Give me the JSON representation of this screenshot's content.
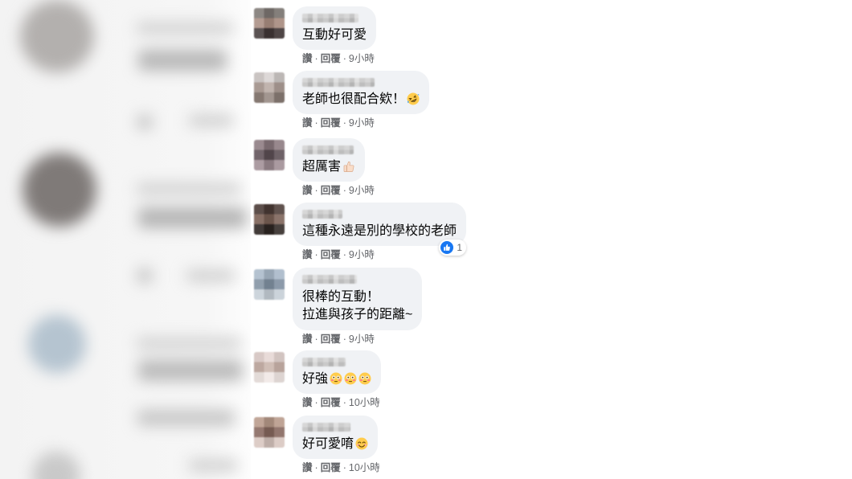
{
  "colors": {
    "bubble": "#f0f2f5",
    "text": "#050505",
    "meta": "#65676b",
    "like_blue": "#1877f2"
  },
  "actions": {
    "like": "讚",
    "reply": "回覆",
    "separator": "·"
  },
  "comments": [
    {
      "lines": [
        "互動好可愛"
      ],
      "emoji": [],
      "time": "9小時"
    },
    {
      "lines": [
        "老師也很配合欸！"
      ],
      "emoji": [
        "rolling-on-floor-laughing"
      ],
      "time": "9小時"
    },
    {
      "lines": [
        "超厲害"
      ],
      "emoji": [
        "thumbs-up"
      ],
      "time": "9小時"
    },
    {
      "lines": [
        "這種永遠是別的學校的老師"
      ],
      "emoji": [],
      "time": "9小時",
      "reaction": {
        "icon": "like",
        "count": 1
      }
    },
    {
      "lines": [
        "很棒的互動！",
        "拉進與孩子的距離~"
      ],
      "emoji": [],
      "time": "9小時"
    },
    {
      "lines": [
        "好強"
      ],
      "emoji": [
        "flushed-face",
        "flushed-face",
        "flushed-face"
      ],
      "time": "10小時"
    },
    {
      "lines": [
        "好可愛唷"
      ],
      "emoji": [
        "smiling-face"
      ],
      "time": "10小時"
    }
  ]
}
